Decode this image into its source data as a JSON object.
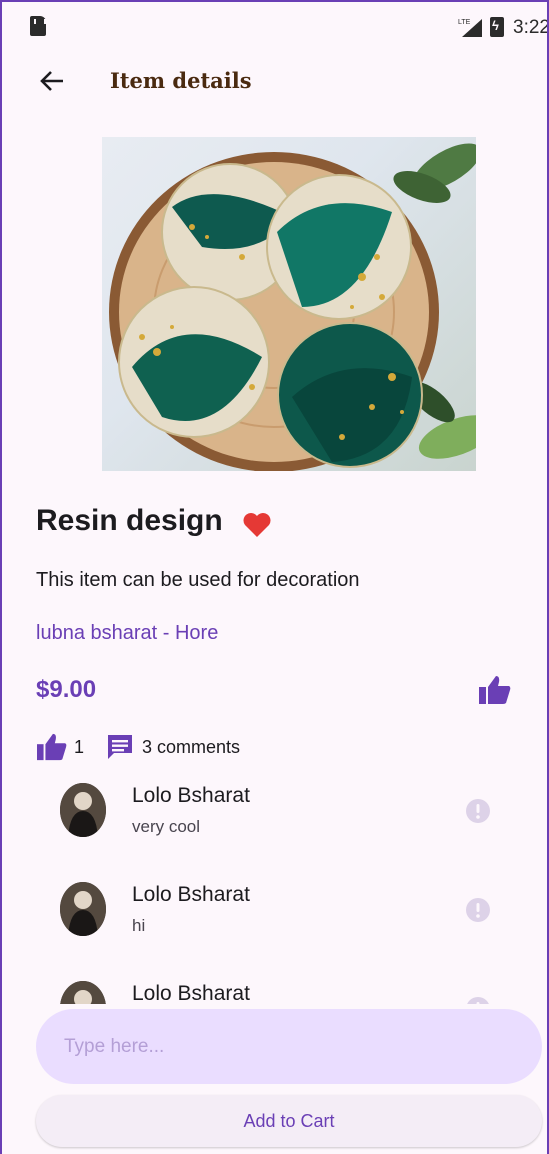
{
  "status_bar": {
    "time": "3:22",
    "network": "LTE"
  },
  "app_bar": {
    "title": "Item details"
  },
  "item": {
    "title": "Resin design",
    "description": "This item can be used for decoration",
    "seller": "lubna bsharat - Hore",
    "price": "$9.00",
    "likes": "1",
    "comments_count": "3 comments"
  },
  "comments": [
    {
      "name": "Lolo Bsharat",
      "text": "very cool"
    },
    {
      "name": "Lolo Bsharat",
      "text": "hi"
    },
    {
      "name": "Lolo Bsharat",
      "text": ""
    }
  ],
  "comment_input": {
    "placeholder": "Type here...",
    "value": ""
  },
  "cart_button": {
    "label": "Add to Cart"
  },
  "colors": {
    "accent": "#6a3fb5",
    "favorite": "#e53935",
    "input_bg": "#eaddff",
    "background": "#fdf7fc"
  },
  "icons": [
    "sim-card-icon",
    "signal-icon",
    "battery-icon",
    "back-arrow-icon",
    "heart-icon",
    "thumb-up-icon",
    "comment-icon",
    "report-icon"
  ]
}
